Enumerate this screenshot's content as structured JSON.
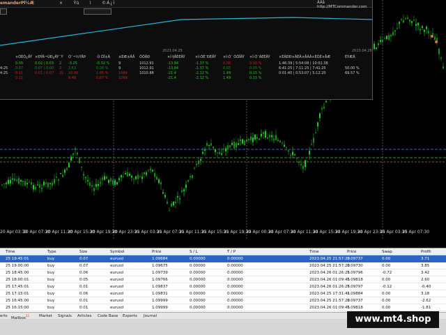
{
  "panel": {
    "app_title": "emanderPl¼Æ",
    "menu_items": [
      "×",
      "Ýù",
      "ì",
      "©Á¿Í"
    ],
    "site": "ÄÂå http://MTCommander.com",
    "date_left": "2023.04.25",
    "date_right": "2023.04.26",
    "header_cells": [
      "×ÓÉÓ¿ÄÝ",
      "×ÐÝÂ¬ÙÐ¿ÄÝ",
      "¨Ý",
      "Ó¯¬½ÝÅÞ",
      "·Û ÓÏ±Ä",
      "±ÉÆ±ÄÅ",
      "ÔÖÂÐ",
      "×Í·§ÅÉÉÄÝ",
      "×Í·ÓÉ¯ÐÉÄÝ",
      "×Í·Ó¯ ÓÔÎÄÝ",
      "×Í·Ó¯ÁÉÉÄÝ",
      "×ÉÂÐÐ×ÄÉÄ×ÅÂÂ×ÈÕÉ×ÅÆ",
      "ÈÝÆÄ"
    ],
    "rows": [
      {
        "time": "",
        "c": [
          "0.05",
          "0.02 | 0.03",
          "2",
          "-3.25",
          "-0.32 %",
          "9",
          "1012.91",
          "-13.84",
          "-1.37 %",
          "0.00",
          "0.00 %",
          "1:46:39 | 5:54:08 | 10:01:38",
          ""
        ]
      },
      {
        "time": "4:25",
        "c": [
          "0.07",
          "0.07 | 0.00",
          "2",
          "2.63",
          "0.26 %",
          "9",
          "1012.91",
          "-13.84",
          "-1.37 %",
          "0.55",
          "0.05 %",
          "6:41:25 | 7:11:25 | 7:41:25",
          "50.00 %"
        ]
      },
      {
        "time": "4:25",
        "c": [
          "0.11",
          "0.01 | 0.07",
          "21",
          "10.80",
          "1.05 %",
          "1069",
          "1010.88",
          "-21.4",
          "-2.12 %",
          "1.49",
          "0.15 %",
          "0:01:40 | 0:53:07 | 5:12:20",
          "69.57 %"
        ]
      },
      {
        "time": "",
        "c": [
          "0.11",
          "",
          "",
          "9.46",
          "0.87 %",
          "1069",
          "",
          "-21.4",
          "-2.12 %",
          "1.49",
          "0.15 %",
          "",
          ""
        ]
      }
    ]
  },
  "chart": {
    "x_labels": [
      "20 Apr 03:30",
      "20 Apr 07:30",
      "20 Apr 11:30",
      "20 Apr 15:30",
      "20 Apr 19:30",
      "20 Apr 23:30",
      "21 Apr 03:30",
      "21 Apr 07:30",
      "21 Apr 11:30",
      "21 Apr 15:30",
      "21 Apr 19:30",
      "24 Apr 00:30",
      "24 Apr 07:30",
      "24 Apr 11:30",
      "24 Apr 15:30",
      "24 Apr 19:30",
      "24 Apr 23:30",
      "25 Apr 03:30",
      "25 Apr 07:30"
    ],
    "bull_color": "#22cc22",
    "bear_color": "#1a8a1a"
  },
  "table": {
    "headers": [
      "Time",
      "Type",
      "Size",
      "Symbol",
      "Price",
      "S / L",
      "T / P",
      "Time",
      "Price",
      "Swap",
      "Profit"
    ],
    "rows": [
      [
        "25 19:45:01",
        "buy",
        "0.07",
        "eurusd",
        "1.09684",
        "0.00000",
        "0.00000",
        "2023.04.25 21:57:20",
        "1.09737",
        "0.00",
        "3.71"
      ],
      [
        "25 19:00:00",
        "buy",
        "0.07",
        "eurusd",
        "1.09675",
        "0.00000",
        "0.00000",
        "2023.04.25 21:57:20",
        "1.09730",
        "0.00",
        "3.85"
      ],
      [
        "25 18:45:00",
        "buy",
        "0.06",
        "eurusd",
        "1.09739",
        "0.00000",
        "0.00000",
        "2023.04.26 01:26:25",
        "1.09796",
        "-0.72",
        "3.42"
      ],
      [
        "25 18:00:01",
        "buy",
        "0.05",
        "eurusd",
        "1.09766",
        "0.00000",
        "0.00000",
        "2023.04.26 01:09:45",
        "1.09818",
        "0.00",
        "2.60"
      ],
      [
        "25 17:45:01",
        "buy",
        "0.01",
        "eurusd",
        "1.09837",
        "0.00000",
        "0.00000",
        "2023.04.26 01:26:25",
        "1.09797",
        "-0.12",
        "-0.40"
      ],
      [
        "25 17:15:01",
        "buy",
        "0.06",
        "eurusd",
        "1.09831",
        "0.00000",
        "0.00000",
        "2023.04.25 17:31:41",
        "1.09884",
        "0.00",
        "3.18"
      ],
      [
        "25 16:45:00",
        "buy",
        "0.01",
        "eurusd",
        "1.09999",
        "0.00000",
        "0.00000",
        "2023.04.25 21:57:20",
        "1.09737",
        "0.00",
        "-2.62"
      ],
      [
        "25 16:15:00",
        "buy",
        "0.01",
        "eurusd",
        "1.09999",
        "0.00000",
        "0.00000",
        "2023.04.26 01:09:45",
        "1.09818",
        "0.00",
        "-1.81"
      ]
    ]
  },
  "tabs": [
    "erts",
    "Mailbox",
    "Market",
    "Signals",
    "Articles",
    "Code Base",
    "Experts",
    "Journal"
  ],
  "mailbox_badge": "11",
  "watermark": "www.mt4.shop"
}
